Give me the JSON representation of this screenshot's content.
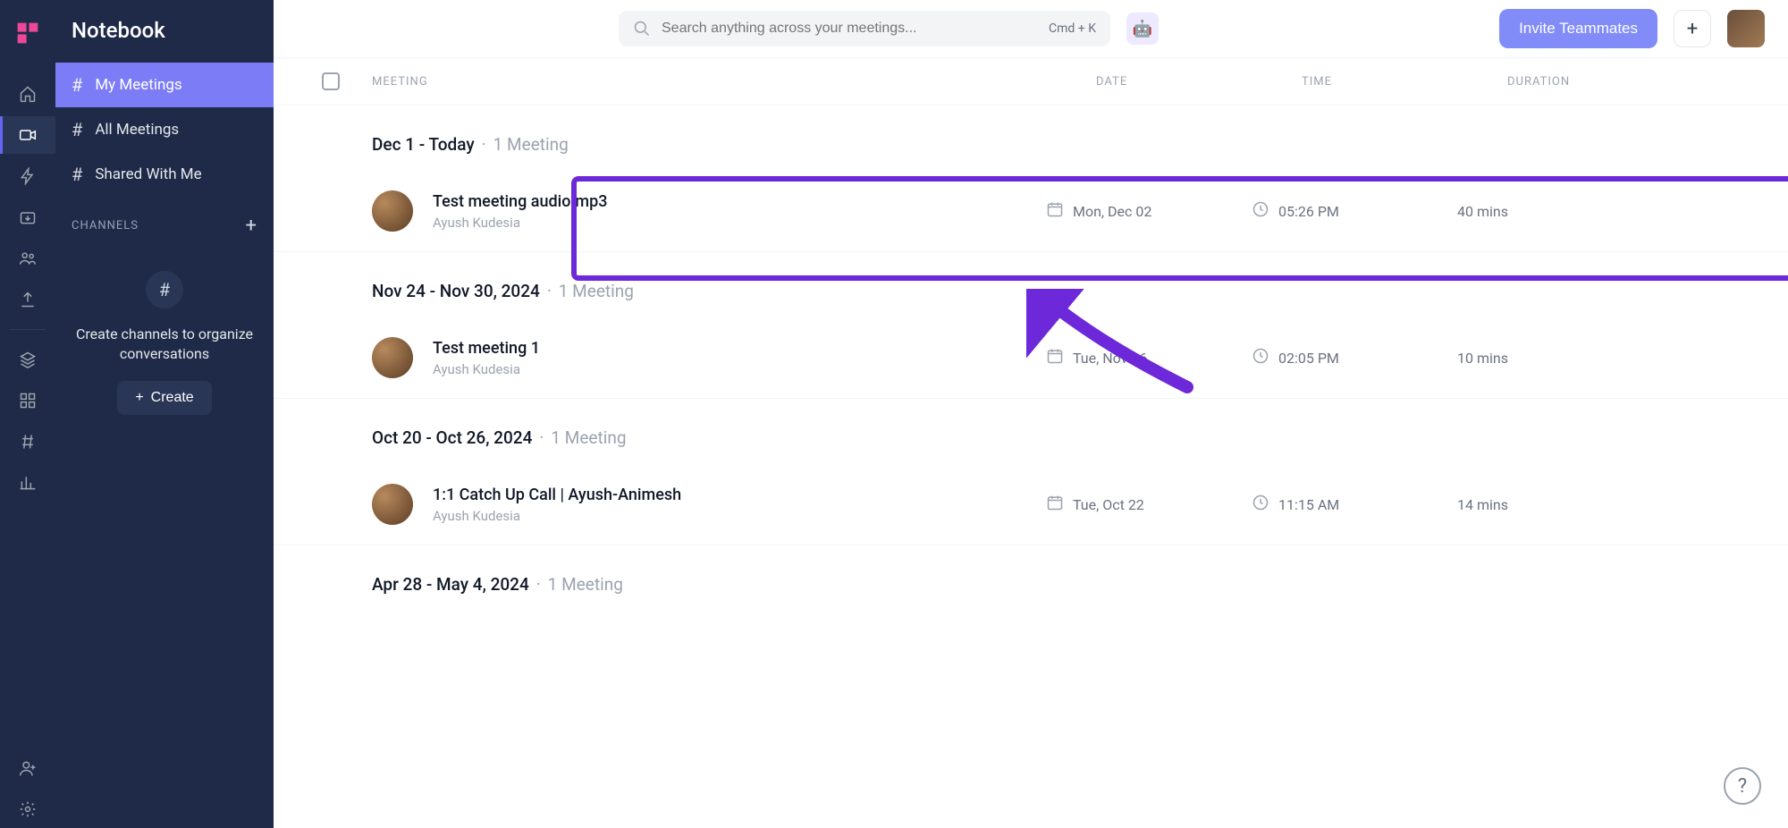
{
  "app_title": "Notebook",
  "search": {
    "placeholder": "Search anything across your meetings...",
    "shortcut": "Cmd + K"
  },
  "header_actions": {
    "invite_label": "Invite Teammates"
  },
  "sidebar": {
    "items": [
      {
        "label": "My Meetings"
      },
      {
        "label": "All Meetings"
      },
      {
        "label": "Shared With Me"
      }
    ],
    "channels_label": "CHANNELS",
    "channels_empty_text": "Create channels to organize conversations",
    "create_label": "Create"
  },
  "table": {
    "cols": {
      "meeting": "MEETING",
      "date": "DATE",
      "time": "TIME",
      "duration": "DURATION"
    }
  },
  "groups": [
    {
      "range": "Dec 1 - Today",
      "count": "1 Meeting",
      "meetings": [
        {
          "title": "Test meeting audio.mp3",
          "host": "Ayush Kudesia",
          "date": "Mon, Dec 02",
          "time": "05:26 PM",
          "duration": "40 mins"
        }
      ]
    },
    {
      "range": "Nov 24 - Nov 30, 2024",
      "count": "1 Meeting",
      "meetings": [
        {
          "title": "Test meeting 1",
          "host": "Ayush Kudesia",
          "date": "Tue, Nov 26",
          "time": "02:05 PM",
          "duration": "10 mins"
        }
      ]
    },
    {
      "range": "Oct 20 - Oct 26, 2024",
      "count": "1 Meeting",
      "meetings": [
        {
          "title": "1:1 Catch Up Call | Ayush-Animesh",
          "host": "Ayush Kudesia",
          "date": "Tue, Oct 22",
          "time": "11:15 AM",
          "duration": "14 mins"
        }
      ]
    },
    {
      "range": "Apr 28 - May 4, 2024",
      "count": "1 Meeting",
      "meetings": []
    }
  ]
}
